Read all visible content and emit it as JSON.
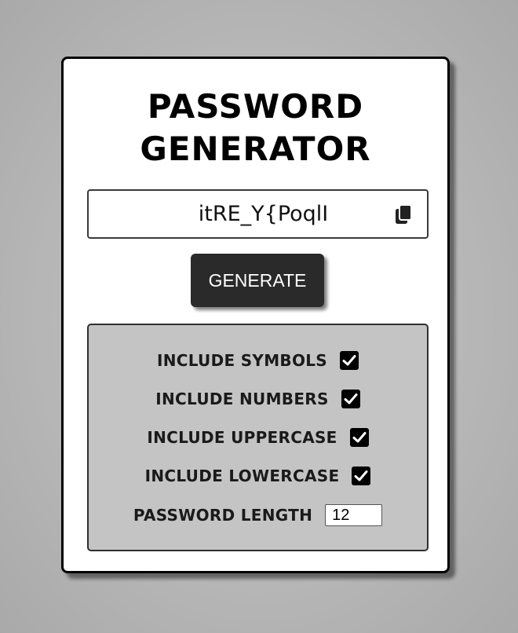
{
  "title": {
    "line1": "PASSWORD",
    "line2": "GENERATOR"
  },
  "password": {
    "value": "itRE_Y{PoqlI",
    "copy_icon": "copy-icon"
  },
  "generate_button": {
    "label": "GENERATE"
  },
  "options": [
    {
      "label": "INCLUDE SYMBOLS",
      "checked": true
    },
    {
      "label": "INCLUDE NUMBERS",
      "checked": true
    },
    {
      "label": "INCLUDE UPPERCASE",
      "checked": true
    },
    {
      "label": "INCLUDE LOWERCASE",
      "checked": true
    }
  ],
  "length": {
    "label": "PASSWORD LENGTH",
    "value": "12"
  },
  "colors": {
    "background": "#b6b6b6",
    "card": "#ffffff",
    "button": "#2a2a2a",
    "options_panel": "#c4c4c4"
  }
}
